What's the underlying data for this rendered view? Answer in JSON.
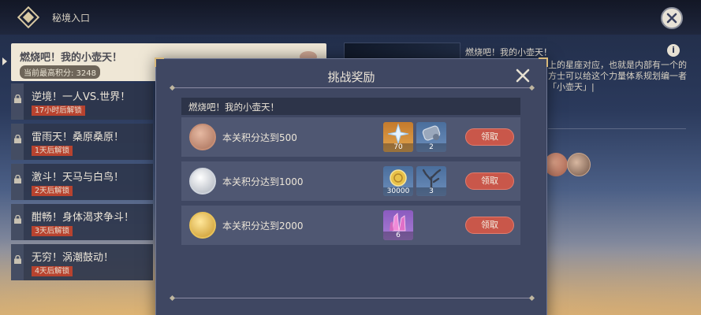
{
  "header": {
    "title": "秘境入口"
  },
  "domains": {
    "active": {
      "name": "燃烧吧！我的小壶天！",
      "score": "当前最高积分: 3248"
    },
    "locked": [
      {
        "name": "逆境！一人VS.世界！",
        "unlock": "17小时后解锁"
      },
      {
        "name": "雷雨天！桑原桑原！",
        "unlock": "1天后解锁"
      },
      {
        "name": "激斗！天马与白鸟！",
        "unlock": "2天后解锁"
      },
      {
        "name": "酣畅！身体渴求争斗！",
        "unlock": "3天后解锁"
      },
      {
        "name": "无穷！涡潮鼓动！",
        "unlock": "4天后解锁"
      }
    ]
  },
  "detail": {
    "title": "燃烧吧！我的小壶天！",
    "text": "上的星座对应，也就是内部有一个的方士可以给这个力量体系规划编一者「小壶天」|"
  },
  "dialog": {
    "title": "挑战奖励",
    "section_title": "燃烧吧！我的小壶天！",
    "rows": [
      {
        "label": "本关积分达到500",
        "medal": "bronze",
        "rewards": [
          {
            "icon": "starglitter-icon",
            "count": "70"
          },
          {
            "icon": "weapon-material-icon",
            "count": "2"
          }
        ],
        "claim": "领取"
      },
      {
        "label": "本关积分达到1000",
        "medal": "silver",
        "rewards": [
          {
            "icon": "mora-icon",
            "count": "30000"
          },
          {
            "icon": "coral-branch-icon",
            "count": "3"
          }
        ],
        "claim": "领取"
      },
      {
        "label": "本关积分达到2000",
        "medal": "gold",
        "rewards": [
          {
            "icon": "crystal-icon",
            "count": "6"
          }
        ],
        "claim": "领取"
      }
    ]
  },
  "colors": {
    "claim_button": "#c9574a",
    "unlock_badge": "#b8432f",
    "dialog_bg": "#3f4762",
    "reward_orange": "#c47a2c",
    "reward_purple": "#8a5bbf",
    "reward_blue": "#4a6e9c"
  }
}
